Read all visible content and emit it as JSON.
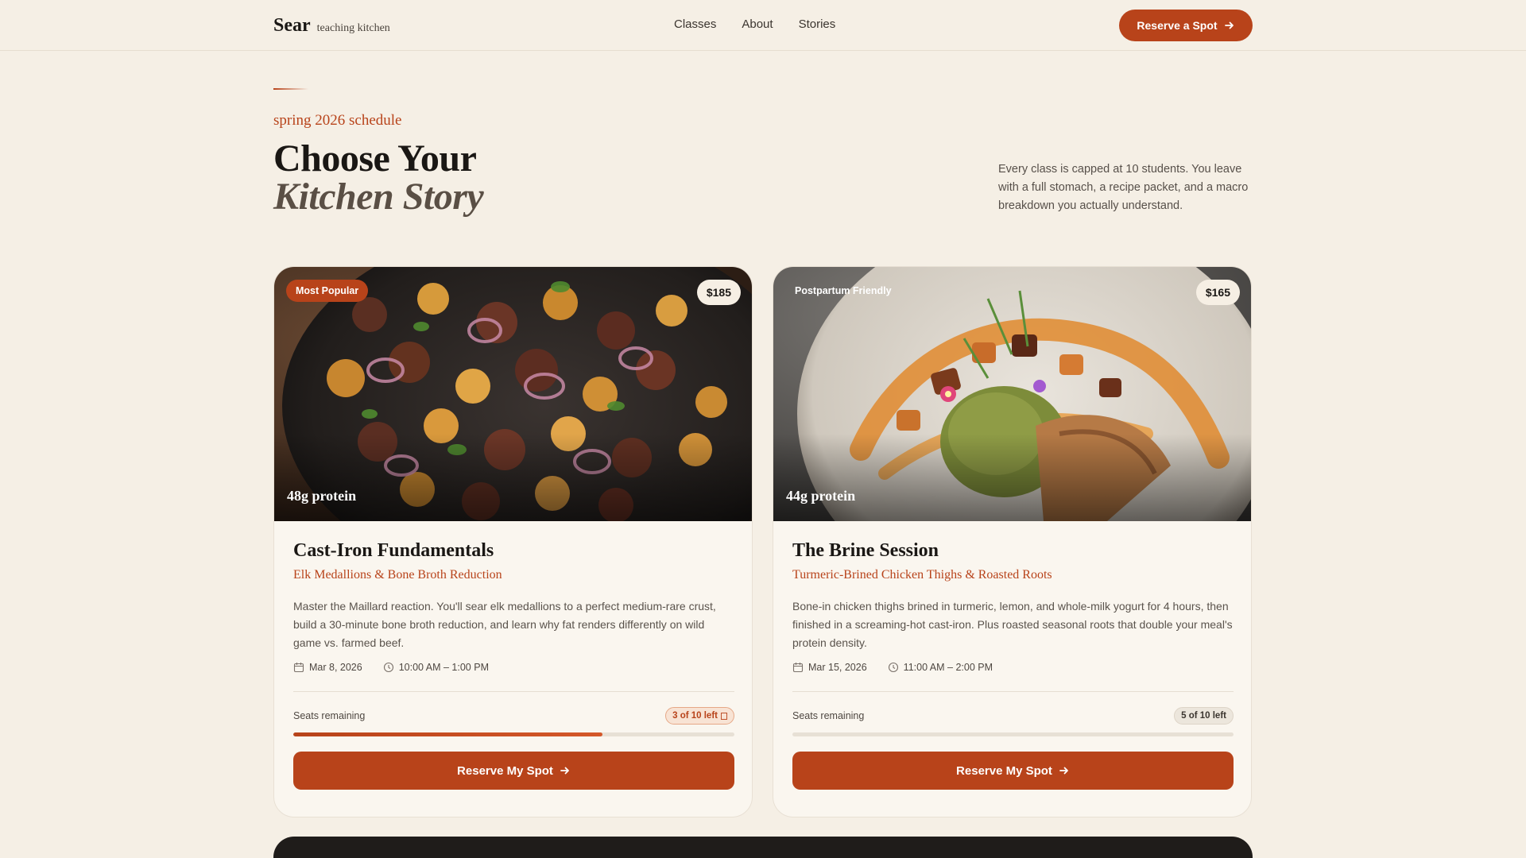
{
  "nav": {
    "brand": "Sear",
    "brand_sub": "teaching kitchen",
    "links": [
      "Classes",
      "About",
      "Stories"
    ],
    "cta": "Reserve a Spot",
    "cta_icon": "arrow-right-icon"
  },
  "hero": {
    "eyebrow": "spring 2026 schedule",
    "title_line1": "Choose Your",
    "title_line2": "Kitchen Story",
    "intro": "Every class is capped at 10 students. You leave with a full stomach, a recipe packet, and a macro breakdown you actually understand."
  },
  "cards": [
    {
      "tag": "Most Popular",
      "price": "$185",
      "protein": "48g protein",
      "name": "Cast-Iron Fundamentals",
      "subtitle": "Elk Medallions & Bone Broth Reduction",
      "description": "Master the Maillard reaction. You'll sear elk medallions to a perfect medium-rare crust, build a 30-minute bone broth reduction, and learn why fat renders differently on wild game vs. farmed beef.",
      "date": "Mar 8, 2026",
      "time": "10:00 AM – 1:00 PM",
      "seats_label": "Seats remaining",
      "seats_badge": "3 of 10 left",
      "seats_fill_fraction": 0.7,
      "button": "Reserve My Spot"
    },
    {
      "tag": "Postpartum Friendly",
      "price": "$165",
      "protein": "44g protein",
      "name": "The Brine Session",
      "subtitle": "Turmeric-Brined Chicken Thighs & Roasted Roots",
      "description": "Bone-in chicken thighs brined in turmeric, lemon, and whole-milk yogurt for 4 hours, then finished in a screaming-hot cast-iron. Plus roasted seasonal roots that double your meal's protein density.",
      "date": "Mar 15, 2026",
      "time": "11:00 AM – 2:00 PM",
      "seats_label": "Seats remaining",
      "seats_badge": "5 of 10 left",
      "seats_fill_fraction": 0.0,
      "button": "Reserve My Spot"
    }
  ],
  "colors": {
    "accent": "#b8431a",
    "background": "#f5efe5",
    "card": "#faf6ef",
    "dark": "#1f1c1a"
  }
}
